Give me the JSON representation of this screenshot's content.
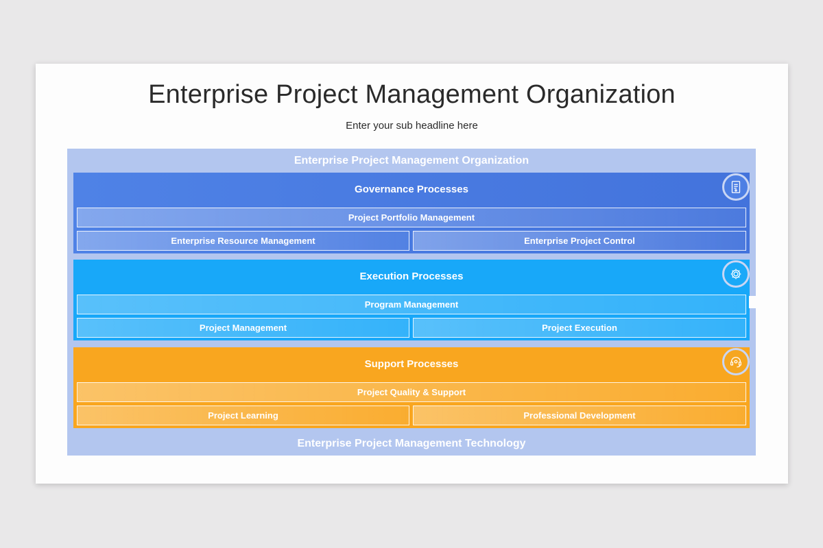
{
  "title": "Enterprise Project Management Organization",
  "subtitle": "Enter your sub headline here",
  "diagram": {
    "header": "Enterprise Project Management Organization",
    "footer": "Enterprise Project Management Technology",
    "colors": {
      "frame": "#b3c6ef",
      "governance": "#4a7be2",
      "execution": "#18a8f9",
      "support": "#f9a61f"
    },
    "bands": [
      {
        "title": "Governance Processes",
        "icon": "document-icon",
        "full": "Project Portfolio Management",
        "left": "Enterprise Resource Management",
        "right": "Enterprise Project Control"
      },
      {
        "title": "Execution Processes",
        "icon": "gear-icon",
        "full": "Program Management",
        "left": "Project Management",
        "right": "Project Execution"
      },
      {
        "title": "Support Processes",
        "icon": "headset-support-icon",
        "full": "Project Quality & Support",
        "left": "Project Learning",
        "right": "Professional Development"
      }
    ]
  }
}
